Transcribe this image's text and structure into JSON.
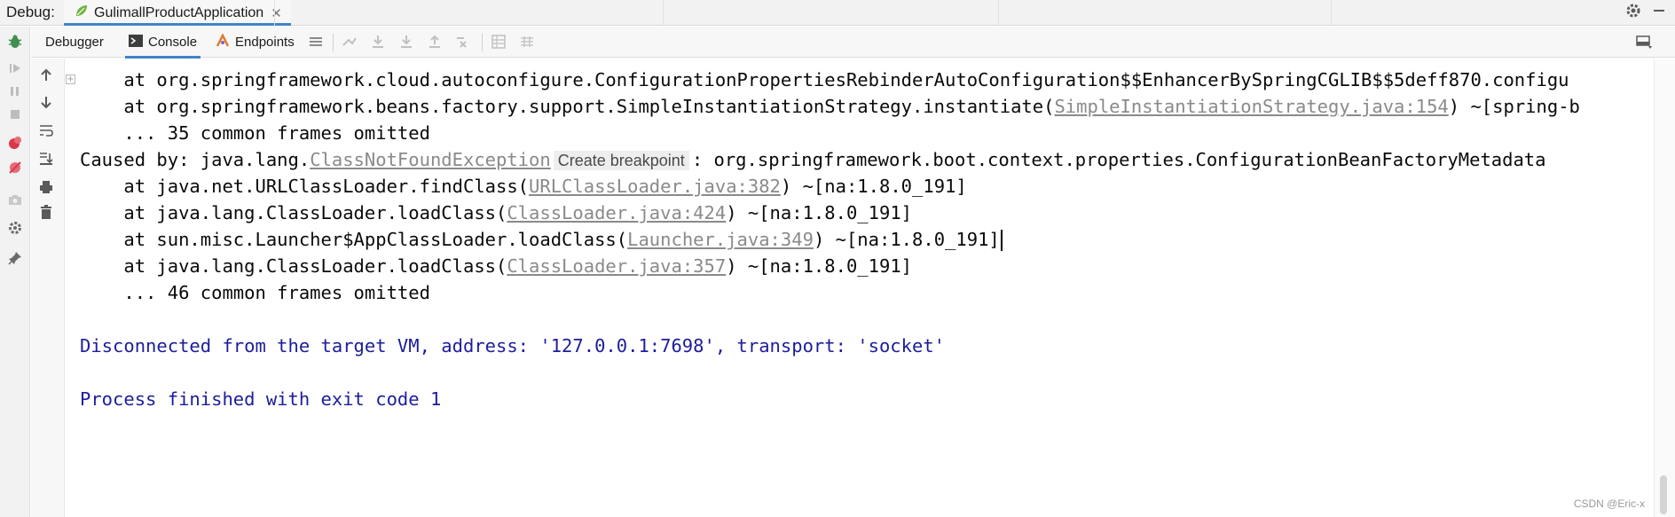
{
  "header": {
    "debug_label": "Debug:",
    "run_tab": "GulimallProductApplication"
  },
  "toolbar": {
    "tabs": [
      {
        "label": "Debugger"
      },
      {
        "label": "Console"
      },
      {
        "label": "Endpoints"
      }
    ],
    "active_tab": "Console"
  },
  "console": {
    "lines": [
      {
        "text": "    at org.springframework.cloud.autoconfigure.ConfigurationPropertiesRebinderAutoConfiguration$$EnhancerBySpringCGLIB$$5deff870.configu"
      },
      {
        "pre": "    at org.springframework.beans.factory.support.SimpleInstantiationStrategy.instantiate(",
        "link": "SimpleInstantiationStrategy.java:154",
        "post": ") ~[spring-b"
      },
      {
        "text": "    ... 35 common frames omitted"
      },
      {
        "pre": "Caused by: java.lang.",
        "link": "ClassNotFoundException",
        "tooltip": "Create breakpoint",
        "post": ": org.springframework.boot.context.properties.ConfigurationBeanFactoryMetadata"
      },
      {
        "pre": "    at java.net.URLClassLoader.findClass(",
        "link": "URLClassLoader.java:382",
        "post": ") ~[na:1.8.0_191]"
      },
      {
        "pre": "    at java.lang.ClassLoader.loadClass(",
        "link": "ClassLoader.java:424",
        "post": ") ~[na:1.8.0_191]"
      },
      {
        "pre": "    at sun.misc.Launcher$AppClassLoader.loadClass(",
        "link": "Launcher.java:349",
        "post": ") ~[na:1.8.0_191]"
      },
      {
        "pre": "    at java.lang.ClassLoader.loadClass(",
        "link": "ClassLoader.java:357",
        "post": ") ~[na:1.8.0_191]"
      },
      {
        "text": "    ... 46 common frames omitted"
      },
      {
        "text": "Disconnected from the target VM, address: '127.0.0.1:7698', transport: 'socket'"
      },
      {
        "text": "Process finished with exit code 1"
      }
    ]
  },
  "watermark": "CSDN @Eric-x",
  "colors": {
    "accent": "#4083c9",
    "system_text": "#1d1d9a",
    "link_text": "#8a8a8a",
    "debug_green": "#3f8f4e",
    "breakpoint_red": "#d9384b"
  }
}
